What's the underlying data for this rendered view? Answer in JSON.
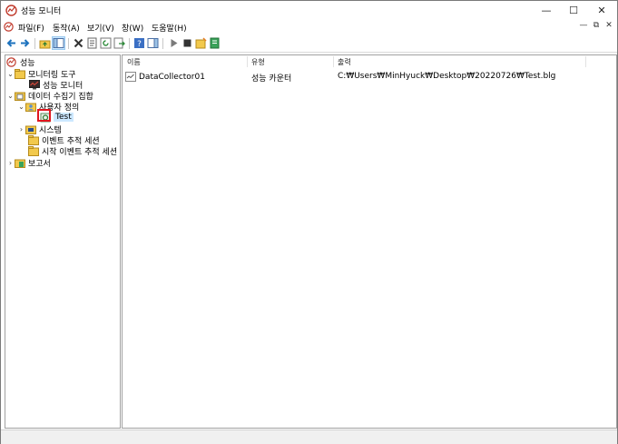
{
  "window": {
    "title": "성능 모니터",
    "minimize": "—",
    "maximize": "☐",
    "close": "✕"
  },
  "menu": {
    "items": [
      "파일(F)",
      "동작(A)",
      "보기(V)",
      "창(W)",
      "도움말(H)"
    ],
    "mdi_min": "—",
    "mdi_restore": "⧉",
    "mdi_close": "✕"
  },
  "tree": {
    "root": "성능",
    "monitoring_tools": "모니터링 도구",
    "perf_monitor": "성능 모니터",
    "data_collector_sets": "데이터 수집기 집합",
    "user_defined": "사용자 정의",
    "test": "Test",
    "system": "시스템",
    "event_trace": "이벤트 추적 세션",
    "startup_trace": "시작 이벤트 추적 세션",
    "reports": "보고서"
  },
  "list": {
    "columns": [
      "이름",
      "유형",
      "출력"
    ],
    "rows": [
      {
        "name": "DataCollector01",
        "type": "성능 카운터",
        "output": "C:₩Users₩MinHyuck₩Desktop₩20220726₩Test.blg"
      }
    ]
  },
  "colors": {
    "accent": "#0078d7",
    "selection": "#cce8ff",
    "highlight": "#e0161f"
  }
}
